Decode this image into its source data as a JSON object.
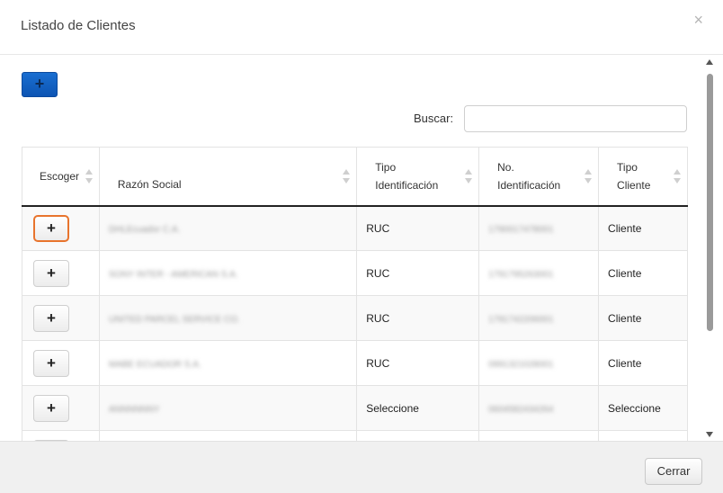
{
  "modal": {
    "title": "Listado de Clientes",
    "close_icon": "×"
  },
  "toolbar": {
    "add_icon": "+"
  },
  "search": {
    "label": "Buscar:",
    "value": "",
    "placeholder": ""
  },
  "table": {
    "headers": {
      "escoger": "Escoger",
      "razon_social": "Razón Social",
      "tipo_identificacion_line1": "Tipo",
      "tipo_identificacion_line2": "Identificación",
      "no_identificacion_line1": "No.",
      "no_identificacion_line2": "Identificación",
      "tipo_cliente_line1": "Tipo",
      "tipo_cliente_line2": "Cliente"
    },
    "pick_icon": "+",
    "rows": [
      {
        "razon_social": "DHLEcuador C.A.",
        "tipo_identificacion": "RUC",
        "no_identificacion": "1790017478001",
        "tipo_cliente": "Cliente"
      },
      {
        "razon_social": "SONY INTER - AMERICAN S.A.",
        "tipo_identificacion": "RUC",
        "no_identificacion": "1791795263001",
        "tipo_cliente": "Cliente"
      },
      {
        "razon_social": "UNITED PARCEL SERVICE CO.",
        "tipo_identificacion": "RUC",
        "no_identificacion": "1791742206001",
        "tipo_cliente": "Cliente"
      },
      {
        "razon_social": "MABE ECUADOR S.A.",
        "tipo_identificacion": "RUC",
        "no_identificacion": "0991321028001",
        "tipo_cliente": "Cliente"
      },
      {
        "razon_social": "ANNNNNNY",
        "tipo_identificacion": "Seleccione",
        "no_identificacion": "0604582434264",
        "tipo_cliente": "Seleccione"
      },
      {
        "razon_social": "",
        "tipo_identificacion": "",
        "no_identificacion": "",
        "tipo_cliente": ""
      }
    ]
  },
  "footer": {
    "close_label": "Cerrar"
  }
}
